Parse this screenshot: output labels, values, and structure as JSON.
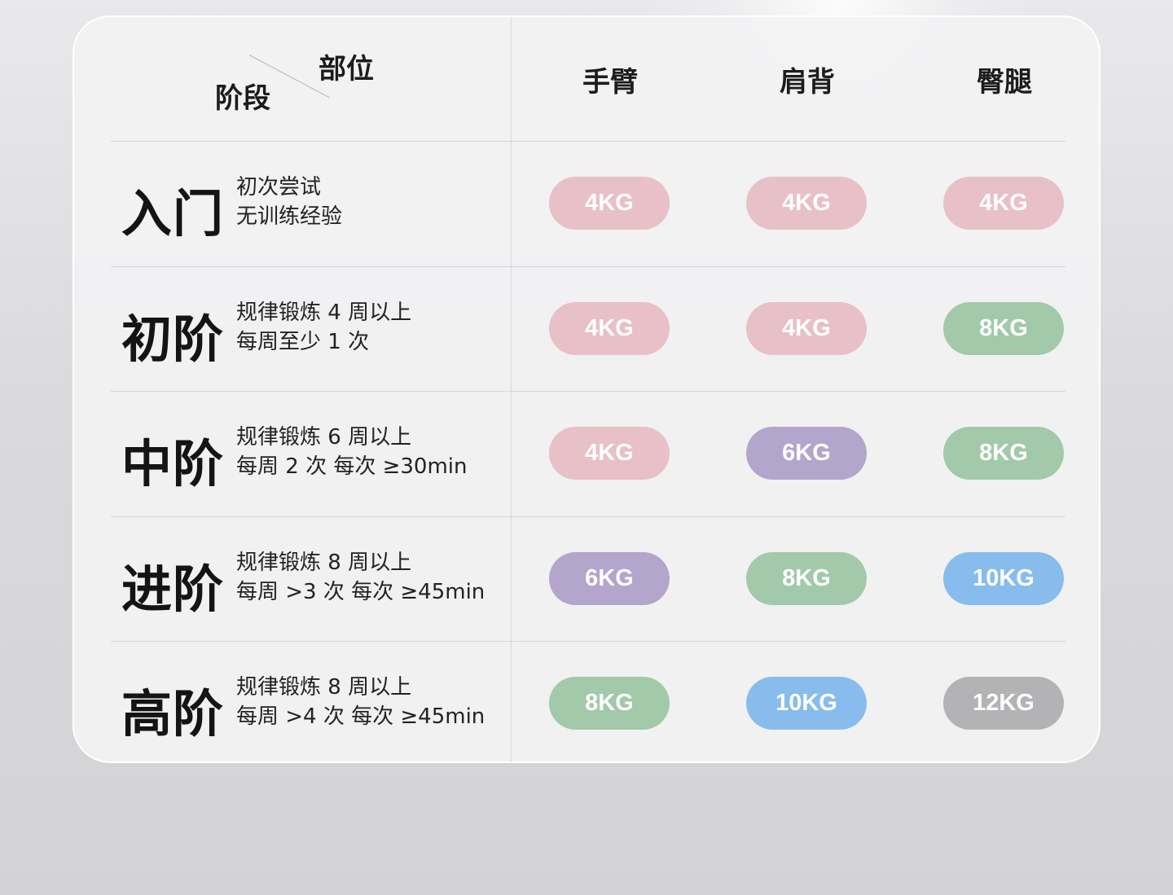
{
  "header": {
    "part_label": "部位",
    "stage_label": "阶段",
    "columns": [
      "手臂",
      "肩背",
      "臀腿"
    ]
  },
  "rows": [
    {
      "stage": "入门",
      "desc1": "初次尝试",
      "desc2": "无训练经验",
      "weights": [
        "4KG",
        "4KG",
        "4KG"
      ],
      "colors": [
        "#e8c0c8",
        "#e8c0c8",
        "#e8c0c8"
      ]
    },
    {
      "stage": "初阶",
      "desc1": "规律锻炼 4 周以上",
      "desc2": "每周至少 1 次",
      "weights": [
        "4KG",
        "4KG",
        "8KG"
      ],
      "colors": [
        "#e8c0c8",
        "#e8c0c8",
        "#a2c9aa"
      ]
    },
    {
      "stage": "中阶",
      "desc1": "规律锻炼 6 周以上",
      "desc2": "每周 2 次 每次 ≥30min",
      "weights": [
        "4KG",
        "6KG",
        "8KG"
      ],
      "colors": [
        "#e8c0c8",
        "#b4a5cc",
        "#a2c9aa"
      ]
    },
    {
      "stage": "进阶",
      "desc1": "规律锻炼 8 周以上",
      "desc2": "每周 >3 次 每次 ≥45min",
      "weights": [
        "6KG",
        "8KG",
        "10KG"
      ],
      "colors": [
        "#b4a5cc",
        "#a2c9aa",
        "#88bcec"
      ]
    },
    {
      "stage": "高阶",
      "desc1": "规律锻炼 8 周以上",
      "desc2": "每周 >4 次 每次 ≥45min",
      "weights": [
        "8KG",
        "10KG",
        "12KG"
      ],
      "colors": [
        "#a2c9aa",
        "#88bcec",
        "#b3b3b5"
      ]
    }
  ]
}
